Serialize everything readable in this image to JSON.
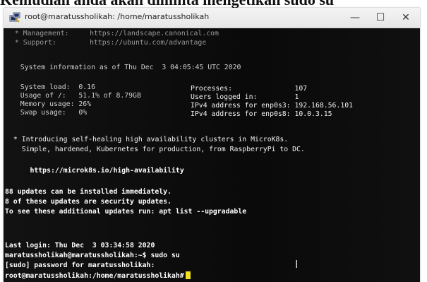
{
  "page_top_text": "Kemudian anda akan diminta mengetikan sudo su",
  "window": {
    "title": "root@maratussholikah: /home/maratussholikah",
    "icon": "putty-terminal-icon",
    "minimize": "—",
    "maximize": "☐",
    "close": "✕"
  },
  "terminal": {
    "management": " * Management:     https://landscape.canonical.com",
    "support": " * Support:        https://ubuntu.com/advantage",
    "sysinfo": "  System information as of Thu Dec  3 04:05:45 UTC 2020",
    "stats_left": [
      "  System load:  0.16",
      "  Usage of /:   51.1% of 8.79GB",
      "  Memory usage: 26%",
      "  Swap usage:   0%"
    ],
    "stats_right": [
      "Processes:               107",
      "Users logged in:         1",
      "IPv4 address for enp0s3: 192.168.56.101",
      "IPv4 address for enp0s8: 10.0.3.15"
    ],
    "microk8s_1": " * Introducing self-healing high availability clusters in MicroK8s.",
    "microk8s_2": "   Simple, hardened, Kubernetes for production, from RaspberryPi to DC.",
    "microk8s_url": "     https://microk8s.io/high-availability",
    "updates_1": "88 updates can be installed immediately.",
    "updates_2": "8 of these updates are security updates.",
    "updates_3": "To see these additional updates run: apt list --upgradable",
    "last_login": "Last login: Thu Dec  3 03:34:58 2020",
    "command_line": "maratussholikah@maratussholikah:~$ sudo su",
    "sudo_prompt": "[sudo] password for maratussholikah:",
    "root_prompt": "root@maratussholikah:/home/maratussholikah#"
  }
}
